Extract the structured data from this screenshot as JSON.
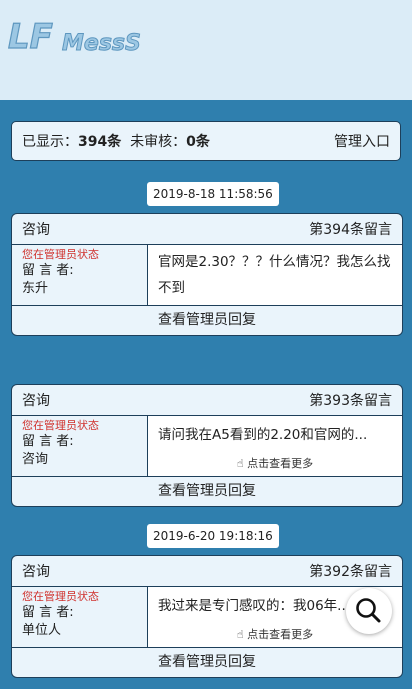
{
  "header": {
    "logo_text": "LFMessS"
  },
  "stats": {
    "shown_label": "已显示：",
    "shown_count": "394条",
    "pending_label": "未审核：",
    "pending_count": "0条",
    "admin_link": "管理入口"
  },
  "messages": [
    {
      "date": "2019-8-18 11:58:56",
      "category": "咨询",
      "number": "第394条留言",
      "admin_state": "您在管理员状态",
      "author_label": "留 言 者:",
      "author": "东升",
      "content": "官网是2.30？？？什么情况？我怎么找不到",
      "more": "",
      "reply_button": "查看管理员回复"
    },
    {
      "date": "",
      "category": "咨询",
      "number": "第393条留言",
      "admin_state": "您在管理员状态",
      "author_label": "留 言 者:",
      "author": "咨询",
      "content": "请问我在A5看到的2.20和官网的...",
      "more": "点击查看更多",
      "reply_button": "查看管理员回复"
    },
    {
      "date": "2019-6-20 19:18:16",
      "category": "咨询",
      "number": "第392条留言",
      "admin_state": "您在管理员状态",
      "author_label": "留 言 者:",
      "author": "单位人",
      "content": "我过来是专门感叹的：我06年...",
      "more": "点击查看更多",
      "reply_button": "查看管理员回复"
    }
  ],
  "colors": {
    "background": "#2f7fae",
    "header": "#dbecf7",
    "card": "#eaf4fb",
    "admin_state": "#d0312d"
  },
  "icons": {
    "hand": "hand-pointer-icon",
    "search": "search-icon"
  }
}
